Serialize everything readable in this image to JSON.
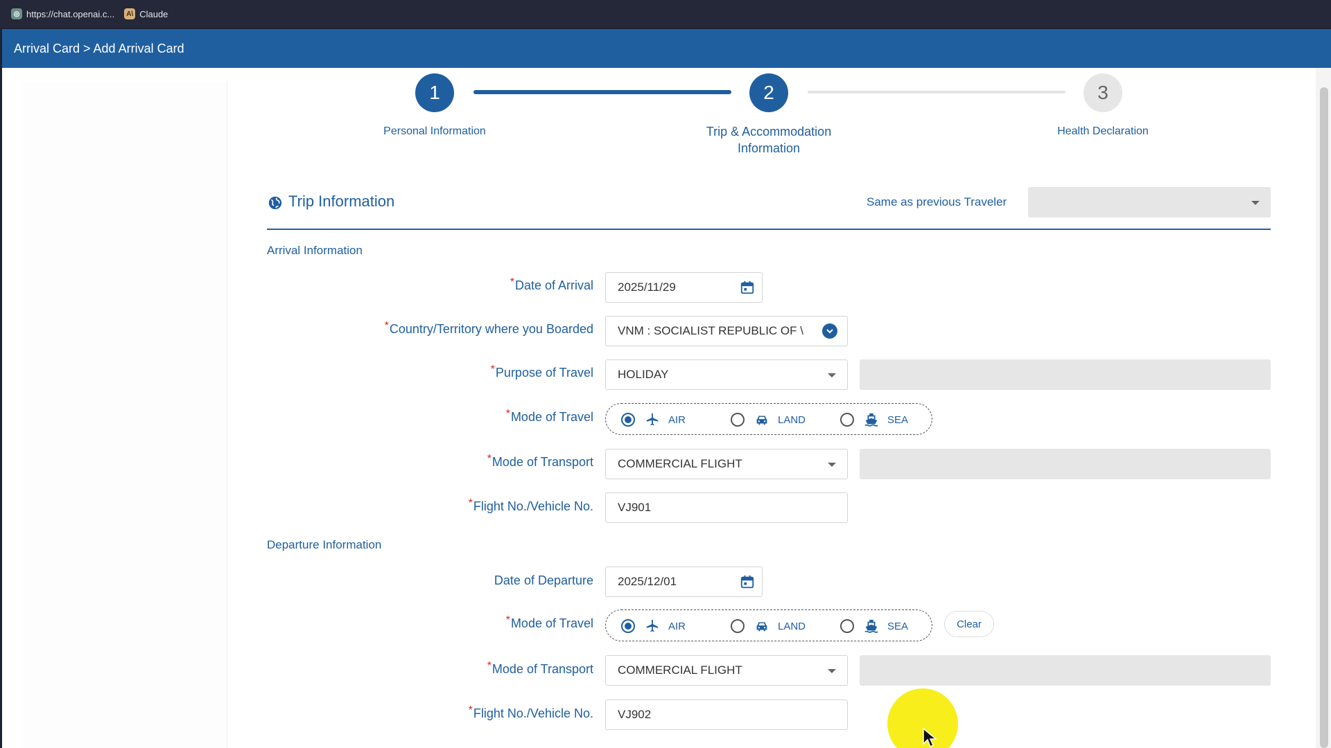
{
  "browser": {
    "bookmarks": [
      {
        "label": "https://chat.openai.c...",
        "icon": "chat-favicon-icon"
      },
      {
        "label": "Claude",
        "icon": "claude-favicon-icon"
      }
    ]
  },
  "header": {
    "breadcrumb": "Arrival Card > Add Arrival Card"
  },
  "stepper": {
    "steps": [
      {
        "number": "1",
        "label": "Personal Information",
        "state": "complete"
      },
      {
        "number": "2",
        "label_line1": "Trip & Accommodation",
        "label_line2": "Information",
        "state": "current"
      },
      {
        "number": "3",
        "label": "Health Declaration",
        "state": "upcoming"
      }
    ]
  },
  "trip": {
    "title": "Trip Information",
    "same_as_label": "Same as previous Traveler",
    "same_as_value": ""
  },
  "arrival": {
    "heading": "Arrival Information",
    "required_mark": "*",
    "date_label": "Date of Arrival",
    "date_value": "2025/11/29",
    "country_label": "Country/Territory where you Boarded",
    "country_value": "VNM : SOCIALIST REPUBLIC OF \\",
    "purpose_label": "Purpose of Travel",
    "purpose_value": "HOLIDAY",
    "mode_travel_label": "Mode of Travel",
    "mode_options": [
      "AIR",
      "LAND",
      "SEA"
    ],
    "mode_selected": "AIR",
    "mode_transport_label": "Mode of Transport",
    "mode_transport_value": "COMMERCIAL FLIGHT",
    "flight_label": "Flight No./Vehicle No.",
    "flight_value": "VJ901"
  },
  "departure": {
    "heading": "Departure Information",
    "date_label": "Date of Departure",
    "date_value": "2025/12/01",
    "mode_travel_label": "Mode of Travel",
    "mode_options": [
      "AIR",
      "LAND",
      "SEA"
    ],
    "mode_selected": "AIR",
    "clear_label": "Clear",
    "mode_transport_label": "Mode of Transport",
    "mode_transport_value": "COMMERCIAL FLIGHT",
    "flight_label": "Flight No./Vehicle No.",
    "flight_value": "VJ902"
  },
  "colors": {
    "primary": "#1f5fa0",
    "required": "#e02020",
    "disabled": "#e6e6e6",
    "cursor_highlight": "#f7ee1c"
  }
}
